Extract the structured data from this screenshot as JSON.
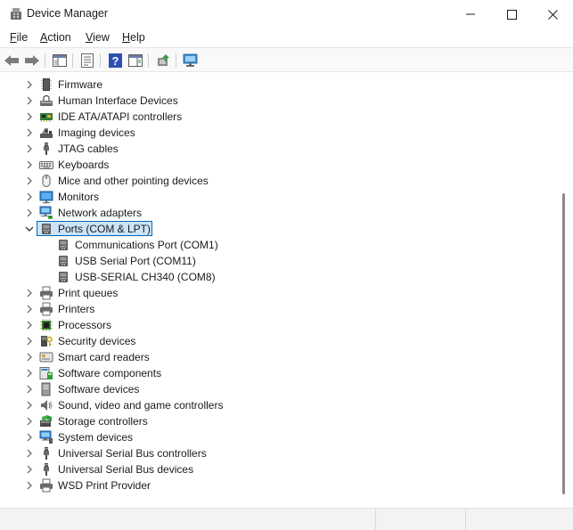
{
  "window": {
    "title": "Device Manager"
  },
  "menu": {
    "file": {
      "key": "F",
      "rest": "ile"
    },
    "action": {
      "key": "A",
      "rest": "ction"
    },
    "view": {
      "key": "V",
      "rest": "iew"
    },
    "help": {
      "key": "H",
      "rest": "elp"
    }
  },
  "toolbar": {
    "buttons": [
      "back-icon",
      "forward-icon",
      "show-hide-console-tree-icon",
      "properties-icon",
      "help-icon",
      "action-pane-icon",
      "update-driver-icon",
      "scan-hardware-icon"
    ]
  },
  "tree": {
    "items": [
      {
        "label": "Firmware",
        "icon": "firmware-icon"
      },
      {
        "label": "Human Interface Devices",
        "icon": "hid-icon"
      },
      {
        "label": "IDE ATA/ATAPI controllers",
        "icon": "ide-controller-icon"
      },
      {
        "label": "Imaging devices",
        "icon": "camera-icon"
      },
      {
        "label": "JTAG cables",
        "icon": "usb-plug-icon"
      },
      {
        "label": "Keyboards",
        "icon": "keyboard-icon"
      },
      {
        "label": "Mice and other pointing devices",
        "icon": "mouse-icon"
      },
      {
        "label": "Monitors",
        "icon": "monitor-icon"
      },
      {
        "label": "Network adapters",
        "icon": "network-adapter-icon"
      },
      {
        "label": "Ports (COM & LPT)",
        "icon": "port-icon"
      },
      {
        "label": "Communications Port (COM1)",
        "icon": "port-icon"
      },
      {
        "label": "USB Serial Port (COM11)",
        "icon": "port-icon"
      },
      {
        "label": "USB-SERIAL CH340 (COM8)",
        "icon": "port-icon"
      },
      {
        "label": "Print queues",
        "icon": "printer-icon"
      },
      {
        "label": "Printers",
        "icon": "printer-icon"
      },
      {
        "label": "Processors",
        "icon": "processor-icon"
      },
      {
        "label": "Security devices",
        "icon": "security-device-icon"
      },
      {
        "label": "Smart card readers",
        "icon": "smart-card-icon"
      },
      {
        "label": "Software components",
        "icon": "software-component-icon"
      },
      {
        "label": "Software devices",
        "icon": "software-device-icon"
      },
      {
        "label": "Sound, video and game controllers",
        "icon": "speaker-icon"
      },
      {
        "label": "Storage controllers",
        "icon": "storage-controller-icon"
      },
      {
        "label": "System devices",
        "icon": "system-device-icon"
      },
      {
        "label": "Universal Serial Bus controllers",
        "icon": "usb-plug-icon"
      },
      {
        "label": "Universal Serial Bus devices",
        "icon": "usb-plug-icon"
      },
      {
        "label": "WSD Print Provider",
        "icon": "printer-icon"
      }
    ]
  },
  "colors": {
    "selection_fill": "#cce4f7",
    "selection_border": "#0067c0",
    "accent": "#0067c0"
  }
}
